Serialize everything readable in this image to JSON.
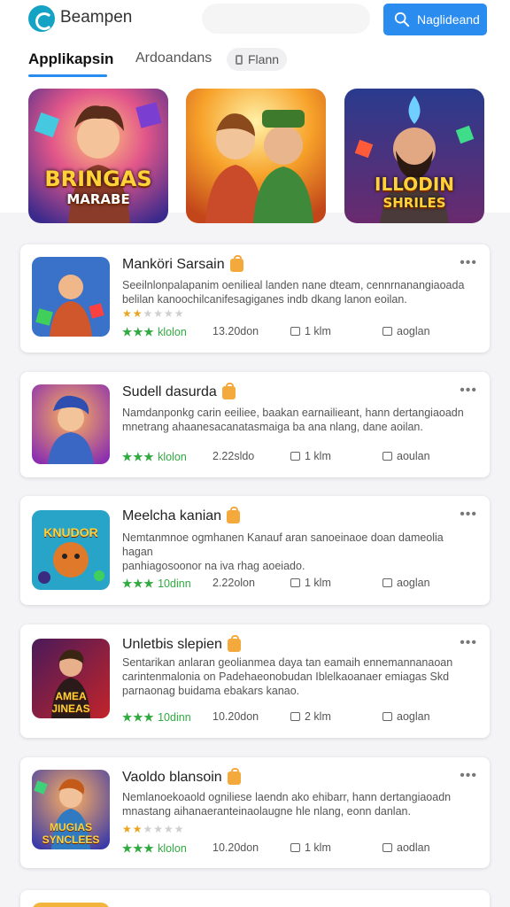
{
  "header": {
    "app_title": "Beampen",
    "search_button": "Naglideand"
  },
  "tabs": [
    {
      "label": "Applikapsin"
    },
    {
      "label": "Ardoandans"
    },
    {
      "label": "Flann"
    }
  ],
  "banners": [
    {
      "line1": "BRINGAS",
      "line2": "MARABE"
    },
    {
      "line1": "",
      "line2": ""
    },
    {
      "line1": "ILLODIN",
      "line2": "SHRILES"
    }
  ],
  "cards": [
    {
      "title": "Manköri Sarsain",
      "description": [
        "Seeilnlonpalapanim oenilieal landen nane dteam, cennrnanangiaoada",
        "belilan kanoochilcanifesagiganes indb dkang lanon eoilan."
      ],
      "rating": 2,
      "green_text": "klolon",
      "size": "13.20don",
      "downloads": "1 klm",
      "tag": "aoglan"
    },
    {
      "title": "Sudell dasurda",
      "description": [
        "Namdanponkg carin eeiliee, baakan earnailieant, hann dertangiaoadn",
        "mnetrang ahaanesacanatasmaiga ba ana nlang, dane aoilan."
      ],
      "rating": 0,
      "green_text": "klolon",
      "size": "2.22sldo",
      "downloads": "1 klm",
      "tag": "aoulan"
    },
    {
      "title": "Meelcha kanian",
      "description": [
        "Nemtanmnoe ogmhanen Kanauf aran sanoeinaoe doan dameolia hagan",
        "panhiagosoonor na iva rhag aoeiado."
      ],
      "rating": 0,
      "green_text": "10dinn",
      "size": "2.22olon",
      "downloads": "1 klm",
      "tag": "aoglan"
    },
    {
      "title": "Unletbis slepien",
      "description": [
        "Sentarikan anlaran geolianmea daya tan eamaih  ennemannanaoan",
        "carintenmalonia on Padehaeonobudan Iblelkaoanaer emiagas Skd",
        "parnaonag buidama ebakars kanao."
      ],
      "rating": 0,
      "green_text": "10dinn",
      "size": "10.20don",
      "downloads": "2 klm",
      "tag": "aoglan"
    },
    {
      "title": "Vaoldo blansoin",
      "description": [
        "Nemlanoekoaold ogniliese laendn ako ehibarr, hann dertangiaoadn",
        "mnastang aihanaeranteinaolaugne hle nlang, eonn danlan."
      ],
      "rating": 2,
      "green_text": "klolon",
      "size": "10.20don",
      "downloads": "1 klm",
      "tag": "aodlan"
    }
  ],
  "icons": {
    "logo": "logo-icon",
    "search": "search-icon",
    "chip": "filter-icon",
    "lock": "lock-icon",
    "more": "more-icon",
    "download": "download-icon",
    "tag": "tag-icon"
  },
  "colors": {
    "accent": "#2b8cf0",
    "logo": "#14a3c4",
    "lock": "#f3a93c",
    "green": "#2faa3f",
    "star": "#e8a620"
  }
}
